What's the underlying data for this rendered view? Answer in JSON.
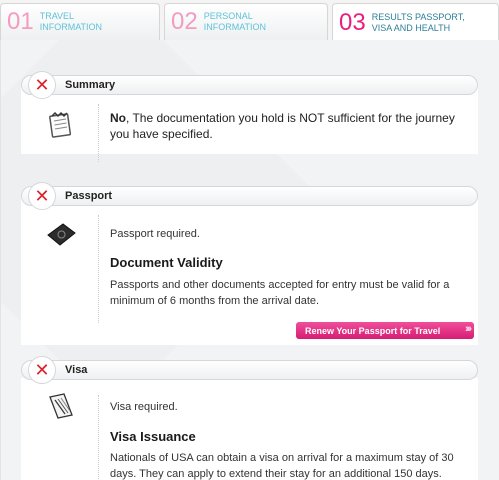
{
  "tabs": [
    {
      "number": "01",
      "label": "TRAVEL\nINFORMATION"
    },
    {
      "number": "02",
      "label": "PERSONAL\nINFORMATION"
    },
    {
      "number": "03",
      "label": "RESULTS PASSPORT,\nVISA AND HEALTH"
    }
  ],
  "summary": {
    "title": "Summary",
    "verdict": "No",
    "message": ", The documentation you hold is NOT sufficient for the journey you have specified."
  },
  "passport": {
    "title": "Passport",
    "required": "Passport required.",
    "validity_heading": "Document Validity",
    "validity_text": "Passports and other documents accepted for entry must be valid for a minimum of 6 months from the arrival date.",
    "renew_button": "Renew Your Passport for Travel"
  },
  "visa": {
    "title": "Visa",
    "required": "Visa required.",
    "issuance_heading": "Visa Issuance",
    "issuance_text": "Nationals of USA can obtain a visa on arrival for a maximum stay of 30 days. They can apply to extend their stay for an additional 150 days."
  },
  "colors": {
    "accent": "#e91e7c",
    "tab_text": "#5ec2d9",
    "status_x": "#d9232e"
  },
  "icons": {
    "status": "x-icon",
    "summary": "notepad-icon",
    "passport": "passport-icon",
    "visa": "visa-document-icon",
    "button_arrows": "chevrons-right-icon"
  }
}
